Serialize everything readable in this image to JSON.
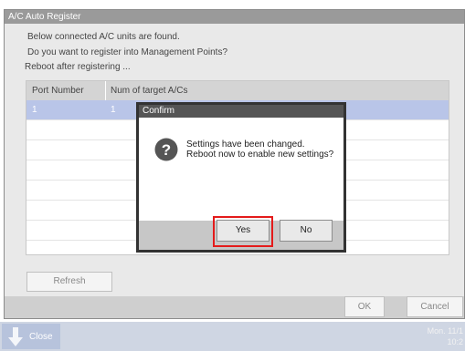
{
  "window": {
    "title": "A/C Auto Register",
    "messages": [
      "Below connected A/C units are found.",
      "Do you want to register into Management Points?",
      "Reboot after registering ..."
    ]
  },
  "table": {
    "headers": [
      "Port Number",
      "Num of target A/Cs"
    ],
    "rows": [
      [
        "1",
        "1"
      ]
    ]
  },
  "buttons": {
    "refresh": "Refresh",
    "ok": "OK",
    "cancel": "Cancel"
  },
  "taskbar": {
    "close_label": "Close",
    "date": "Mon. 11/1",
    "time": "10:2"
  },
  "dialog": {
    "title": "Confirm",
    "line1": "Settings have been changed.",
    "line2": "Reboot now to enable new settings?",
    "yes": "Yes",
    "no": "No",
    "icon": "question-icon"
  },
  "colors": {
    "highlight": "#e41b1b",
    "selected_row": "#b9c5e8",
    "title_bar": "#9a9a9a"
  }
}
